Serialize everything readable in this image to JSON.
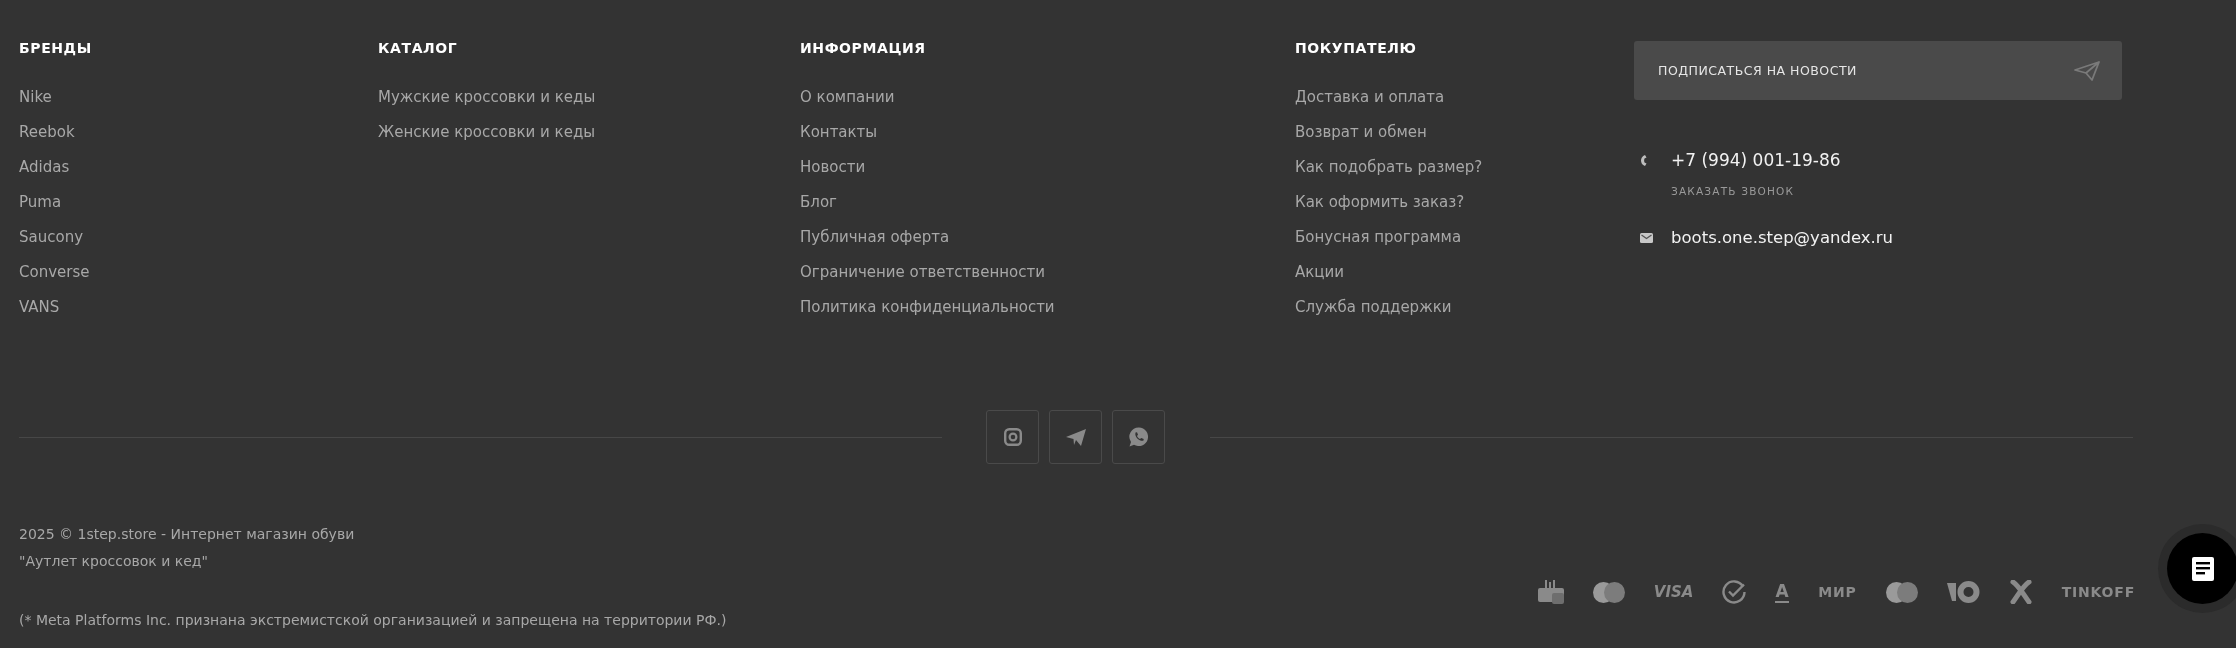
{
  "columns": [
    {
      "title": "БРЕНДЫ",
      "links": [
        "Nike",
        "Reebok",
        "Adidas",
        "Puma",
        "Saucony",
        "Converse",
        "VANS"
      ]
    },
    {
      "title": "КАТАЛОГ",
      "links": [
        "Мужские кроссовки и кеды",
        "Женские кроссовки и кеды"
      ]
    },
    {
      "title": "ИНФОРМАЦИЯ",
      "links": [
        "О компании",
        "Контакты",
        "Новости",
        "Блог",
        "Публичная оферта",
        "Ограничение ответственности",
        "Политика конфиденциальности"
      ]
    },
    {
      "title": "ПОКУПАТЕЛЮ",
      "links": [
        "Доставка и оплата",
        "Возврат и обмен",
        "Как подобрать размер?",
        "Как оформить заказ?",
        "Бонусная программа",
        "Акции",
        "Служба поддержки"
      ]
    }
  ],
  "subscribe": {
    "label": "ПОДПИСАТЬСЯ НА НОВОСТИ"
  },
  "contacts": {
    "phone": "+7 (994) 001-19-86",
    "callback": "ЗАКАЗАТЬ ЗВОНОК",
    "email": "boots.one.step@yandex.ru"
  },
  "social": [
    {
      "kind": "camera"
    },
    {
      "kind": "plane"
    },
    {
      "kind": "bubble"
    }
  ],
  "copyright": [
    "2025 © 1step.store - Интернет магазин обуви",
    "\"Аутлет кроссовок и кед\""
  ],
  "note": "(* Meta Platforms Inc. признана экстремистской организацией и запрещена на территории РФ.)",
  "payments": [
    {
      "kind": "register"
    },
    {
      "kind": "circles"
    },
    {
      "kind": "slanted",
      "label": "VISA"
    },
    {
      "kind": "check"
    },
    {
      "kind": "underlined",
      "label": "A"
    },
    {
      "kind": "wordmark",
      "label": "МИР"
    },
    {
      "kind": "circles"
    },
    {
      "kind": "ring"
    },
    {
      "kind": "cross"
    },
    {
      "kind": "wordmark",
      "label": "TINKOFF"
    }
  ]
}
